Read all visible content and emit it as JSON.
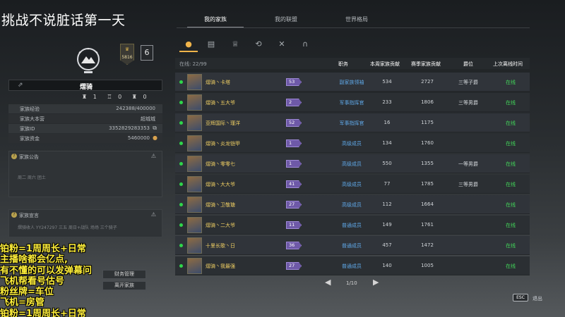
{
  "stream_title": "挑战不说脏话第一天",
  "top_tabs": [
    "我的家族",
    "我的联盟",
    "世界格局"
  ],
  "active_top_tab": "我的家族",
  "family": {
    "rank_number": "5816",
    "level": "6",
    "name": "熠骑",
    "members": {
      "tier1": "1",
      "tier2": "0",
      "tier3": "0"
    },
    "stats": [
      {
        "label": "家族经验",
        "value": "242388/400000"
      },
      {
        "label": "家族大本营",
        "value": "超城城"
      },
      {
        "label": "家族ID",
        "value": "3352829283353"
      },
      {
        "label": "家族资金",
        "value": "5460000"
      }
    ],
    "announcement": {
      "title": "家族公告",
      "text": "周二 周六 团土"
    },
    "manifesto": {
      "title": "家族宣言",
      "text": "熠骑收人 YY247297 三五 周日+战队 场场 三个骑子"
    }
  },
  "buttons": {
    "finance": "财务管理",
    "leave": "离开家族"
  },
  "overlay_lines": [
    "铂粉=1周周长+日常",
    "主播啥都会亿点,",
    "有不懂的可以发弹幕问",
    "飞机帮看号估号",
    "粉丝牌=车位",
    "飞机=房管",
    "铂粉=1周周长+日常"
  ],
  "icon_tabs": [
    "member-icon",
    "scroll-icon",
    "crown-icon",
    "cycle-icon",
    "crossed-swords-icon",
    "helmet-icon"
  ],
  "table": {
    "online_label": "在线: 22/99",
    "headers": {
      "role": "职务",
      "week": "本周家族贡献",
      "season": "赛季家族贡献",
      "title": "爵位",
      "last": "上次离线时间"
    },
    "rows": [
      {
        "name": "熠骑丶卡塔",
        "level": "53",
        "role": "副家族领袖",
        "week": "534",
        "season": "2727",
        "title": "三等子爵",
        "last": "在线"
      },
      {
        "name": "熠骑丶五大爷",
        "level": "2",
        "role": "军事指挥官",
        "week": "233",
        "season": "1806",
        "title": "三等男爵",
        "last": "在线"
      },
      {
        "name": "亚辉国际丶瑾洋",
        "level": "52",
        "role": "军事指挥官",
        "week": "16",
        "season": "1175",
        "title": "",
        "last": "在线"
      },
      {
        "name": "熠骑丶炎龙铠甲",
        "level": "1",
        "role": "高级成员",
        "week": "134",
        "season": "1760",
        "title": "",
        "last": "在线"
      },
      {
        "name": "熠骑丶零零七",
        "level": "1",
        "role": "高级成员",
        "week": "550",
        "season": "1355",
        "title": "一等男爵",
        "last": "在线"
      },
      {
        "name": "熠骑丶大大爷",
        "level": "41",
        "role": "高级成员",
        "week": "77",
        "season": "1785",
        "title": "三等男爵",
        "last": "在线"
      },
      {
        "name": "熠骑丶卫敬瑭",
        "level": "27",
        "role": "高级成员",
        "week": "112",
        "season": "1664",
        "title": "",
        "last": "在线"
      },
      {
        "name": "熠骑丶二大爷",
        "level": "11",
        "role": "普通成员",
        "week": "149",
        "season": "1761",
        "title": "",
        "last": "在线"
      },
      {
        "name": "十里长歌丶日",
        "level": "36",
        "role": "普通成员",
        "week": "457",
        "season": "1472",
        "title": "",
        "last": "在线"
      },
      {
        "name": "熠骑丶我最强",
        "level": "27",
        "role": "普通成员",
        "week": "140",
        "season": "1005",
        "title": "",
        "last": "在线"
      }
    ]
  },
  "pagination": {
    "page": "1/10"
  },
  "esc": {
    "key": "ESC",
    "label": "退出"
  },
  "colors": {
    "online": "#2fd64a",
    "name_gold": "#f0cf63",
    "role_blue": "#5fa8e8",
    "accent_orange": "#f0b44a",
    "overlay_yellow": "#ffef3a"
  }
}
